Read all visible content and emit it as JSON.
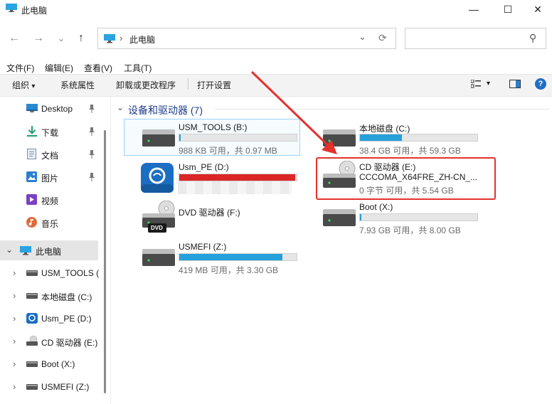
{
  "window": {
    "title": "此电脑",
    "min_glyph": "—",
    "max_glyph": "☐",
    "close_glyph": "✕"
  },
  "nav": {
    "back_glyph": "←",
    "forward_glyph": "→",
    "recent_glyph": "⌄",
    "up_glyph": "↑",
    "refresh_glyph": "⟳",
    "search_glyph": "⚲"
  },
  "address": {
    "path": "此电脑",
    "sep": "›",
    "dropdown_glyph": "⌄"
  },
  "search": {
    "placeholder": ""
  },
  "menu": [
    "文件(F)",
    "编辑(E)",
    "查看(V)",
    "工具(T)"
  ],
  "toolbar": {
    "organize": "组织",
    "organize_caret": "▾",
    "properties": "系统属性",
    "uninstall": "卸载或更改程序",
    "settings": "打开设置",
    "view_caret": "▾",
    "help_glyph": "?"
  },
  "sidebar": {
    "quick": [
      {
        "label": "Desktop",
        "pinned": true,
        "icon": "desktop-icon"
      },
      {
        "label": "下载",
        "pinned": true,
        "icon": "download-icon"
      },
      {
        "label": "文档",
        "pinned": true,
        "icon": "document-icon"
      },
      {
        "label": "图片",
        "pinned": true,
        "icon": "picture-icon"
      },
      {
        "label": "视频",
        "pinned": false,
        "icon": "video-icon"
      },
      {
        "label": "音乐",
        "pinned": false,
        "icon": "music-icon"
      }
    ],
    "this_pc": "此电脑",
    "expand_glyph": "›",
    "collapse_glyph": "⌄",
    "drives": [
      "USM_TOOLS (",
      "本地磁盘 (C:)",
      "Usm_PE (D:)",
      "CD 驱动器 (E:)",
      "Boot (X:)",
      "USMEFI (Z:)"
    ]
  },
  "section": {
    "title": "设备和驱动器 (7)",
    "caret": "⌄"
  },
  "drives": [
    {
      "name": "USM_TOOLS (B:)",
      "used_fraction": 0.01,
      "capacity": "988 KB 可用，共 0.97 MB",
      "bar_color": "#26a0da"
    },
    {
      "name": "本地磁盘 (C:)",
      "used_fraction": 0.36,
      "capacity": "38.4 GB 可用，共 59.3 GB",
      "bar_color": "#26a0da"
    },
    {
      "name": "Usm_PE (D:)",
      "used_fraction": 0.99,
      "capacity": "",
      "bar_color": "#da2626"
    },
    {
      "name": "CD 驱动器 (E:)",
      "label2": "CCCOMA_X64FRE_ZH-CN_...",
      "capacity": "0 字节 可用，共 5.54 GB"
    },
    {
      "name": "DVD 驱动器 (F:)",
      "dvd_label": "DVD"
    },
    {
      "name": "Boot (X:)",
      "used_fraction": 0.01,
      "capacity": "7.93 GB 可用，共 8.00 GB",
      "bar_color": "#26a0da"
    },
    {
      "name": "USMEFI (Z:)",
      "used_fraction": 0.88,
      "capacity": "419 MB 可用，共 3.30 GB",
      "bar_color": "#26a0da"
    }
  ]
}
